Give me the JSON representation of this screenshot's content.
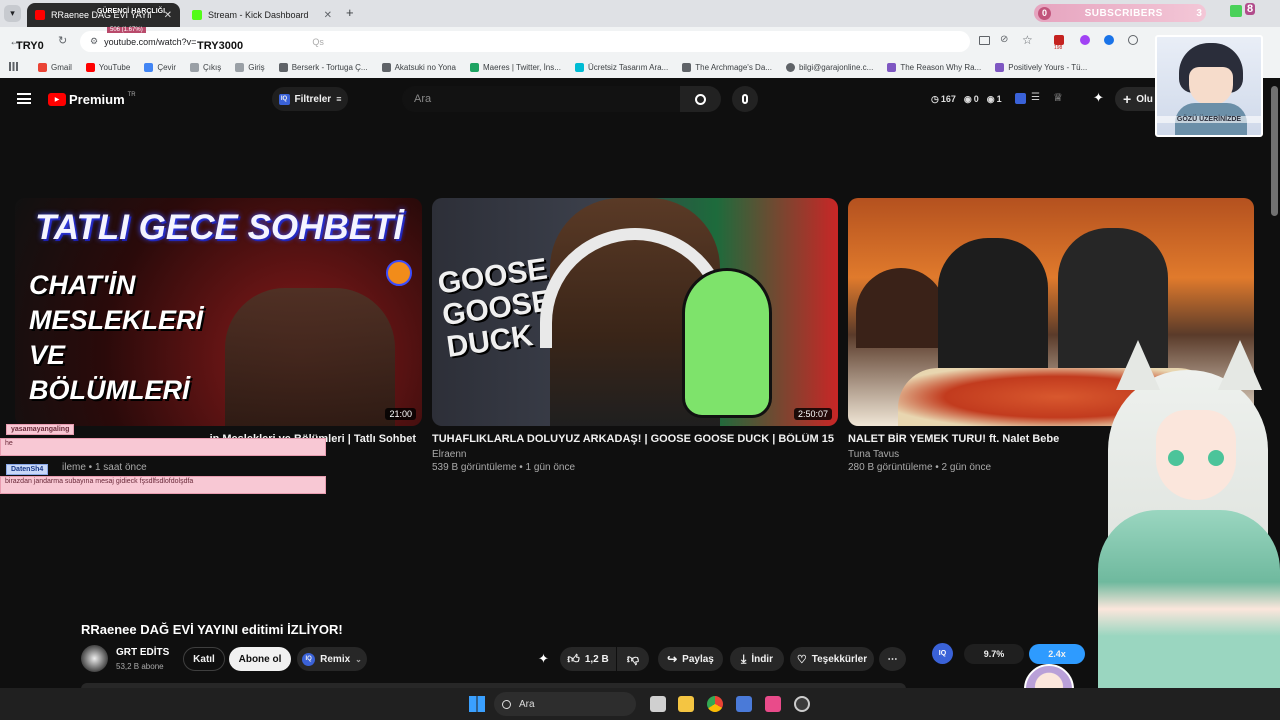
{
  "browser": {
    "tabs": [
      {
        "label": "RRaenee DAĞ EVİ YAYINI editimi İZLİYOR",
        "overlay": "GÜRENCİ HARÇLIĞI",
        "overlay_sub": "506 (1.67%)"
      },
      {
        "label": "Stream - Kick Dashboard"
      }
    ],
    "url": "youtube.com/watch?v=",
    "url_tail": "Qs",
    "overlay_left": "TRY0",
    "overlay_right": "TRY3000",
    "subscribers_label": "SUBSCRIBERS",
    "subscribers_left": "0",
    "subscribers_right": "3",
    "subscribers_badge": "8",
    "ext_count": "198",
    "bookmarks": [
      "Gmail",
      "YouTube",
      "Çevir",
      "Çıkış",
      "Giriş",
      "Berserk - Tortuga Ç...",
      "Akatsuki no Yona",
      "Maeres | Twitter, İns...",
      "Ücretsiz Tasarım Ara...",
      "The Archmage's Da...",
      "bilgi@garajonline.c...",
      "The Reason Why Ra...",
      "Positively Yours - Tü..."
    ]
  },
  "youtube": {
    "logo": "Premium",
    "logo_sup": "TR",
    "filters_label": "Filtreler",
    "search_placeholder": "Ara",
    "stats": {
      "views": "167",
      "a": "0",
      "b": "1"
    },
    "create_label": "Olu",
    "videos": [
      {
        "title": "Tatlı Gece Sohbeti - Chat'in Meslekleri ve Bölümleri | Tatlı Sohbet",
        "title_visible": "in Meslekleri ve Bölümleri | Tatlı Sohbet",
        "meta_visible": "ileme • 1 saat önce",
        "duration": "21:00",
        "thumb_line1": "TATLI GECE SOHBETİ",
        "thumb_lines": [
          "CHAT'İN",
          "MESLEKLERİ",
          "VE",
          "BÖLÜMLERİ"
        ]
      },
      {
        "title": "TUHAFLIKLARLA DOLUYUZ ARKADAŞ! | GOOSE GOOSE DUCK | BÖLÜM 15",
        "channel": "Elraenn",
        "meta": "539 B görüntüleme • 1 gün önce",
        "duration": "2:50:07",
        "thumb_text": "GOOSE GOOSE DUCK"
      },
      {
        "title": "NALET BİR YEMEK TURU! ft. Nalet Bebe",
        "channel": "Tuna Tavus",
        "meta": "280 B görüntüleme • 2 gün önce"
      }
    ],
    "watch": {
      "title": "RRaenee DAĞ EVİ YAYINI editimi İZLİYOR!",
      "channel": "GRT EDİTS",
      "subs": "53,2 B abone",
      "join": "Katıl",
      "subscribe": "Abone ol",
      "remix": "Remix",
      "likes": "1,2 B",
      "share": "Paylaş",
      "download": "İndir",
      "thanks": "Teşekkürler",
      "iq_pct": "9.7%",
      "speed": "2.4x"
    }
  },
  "chat": [
    {
      "user": "yasamayangaling",
      "text": "he"
    },
    {
      "user": "DatenSh4",
      "text": "birazdan jandarma subayına mesaj gidieck fşsdlfsdlofdolşdfa"
    }
  ],
  "overlay_avatar_text": "GÖZÜ ÜZERİNİZDE",
  "taskbar": {
    "search": "Ara"
  }
}
